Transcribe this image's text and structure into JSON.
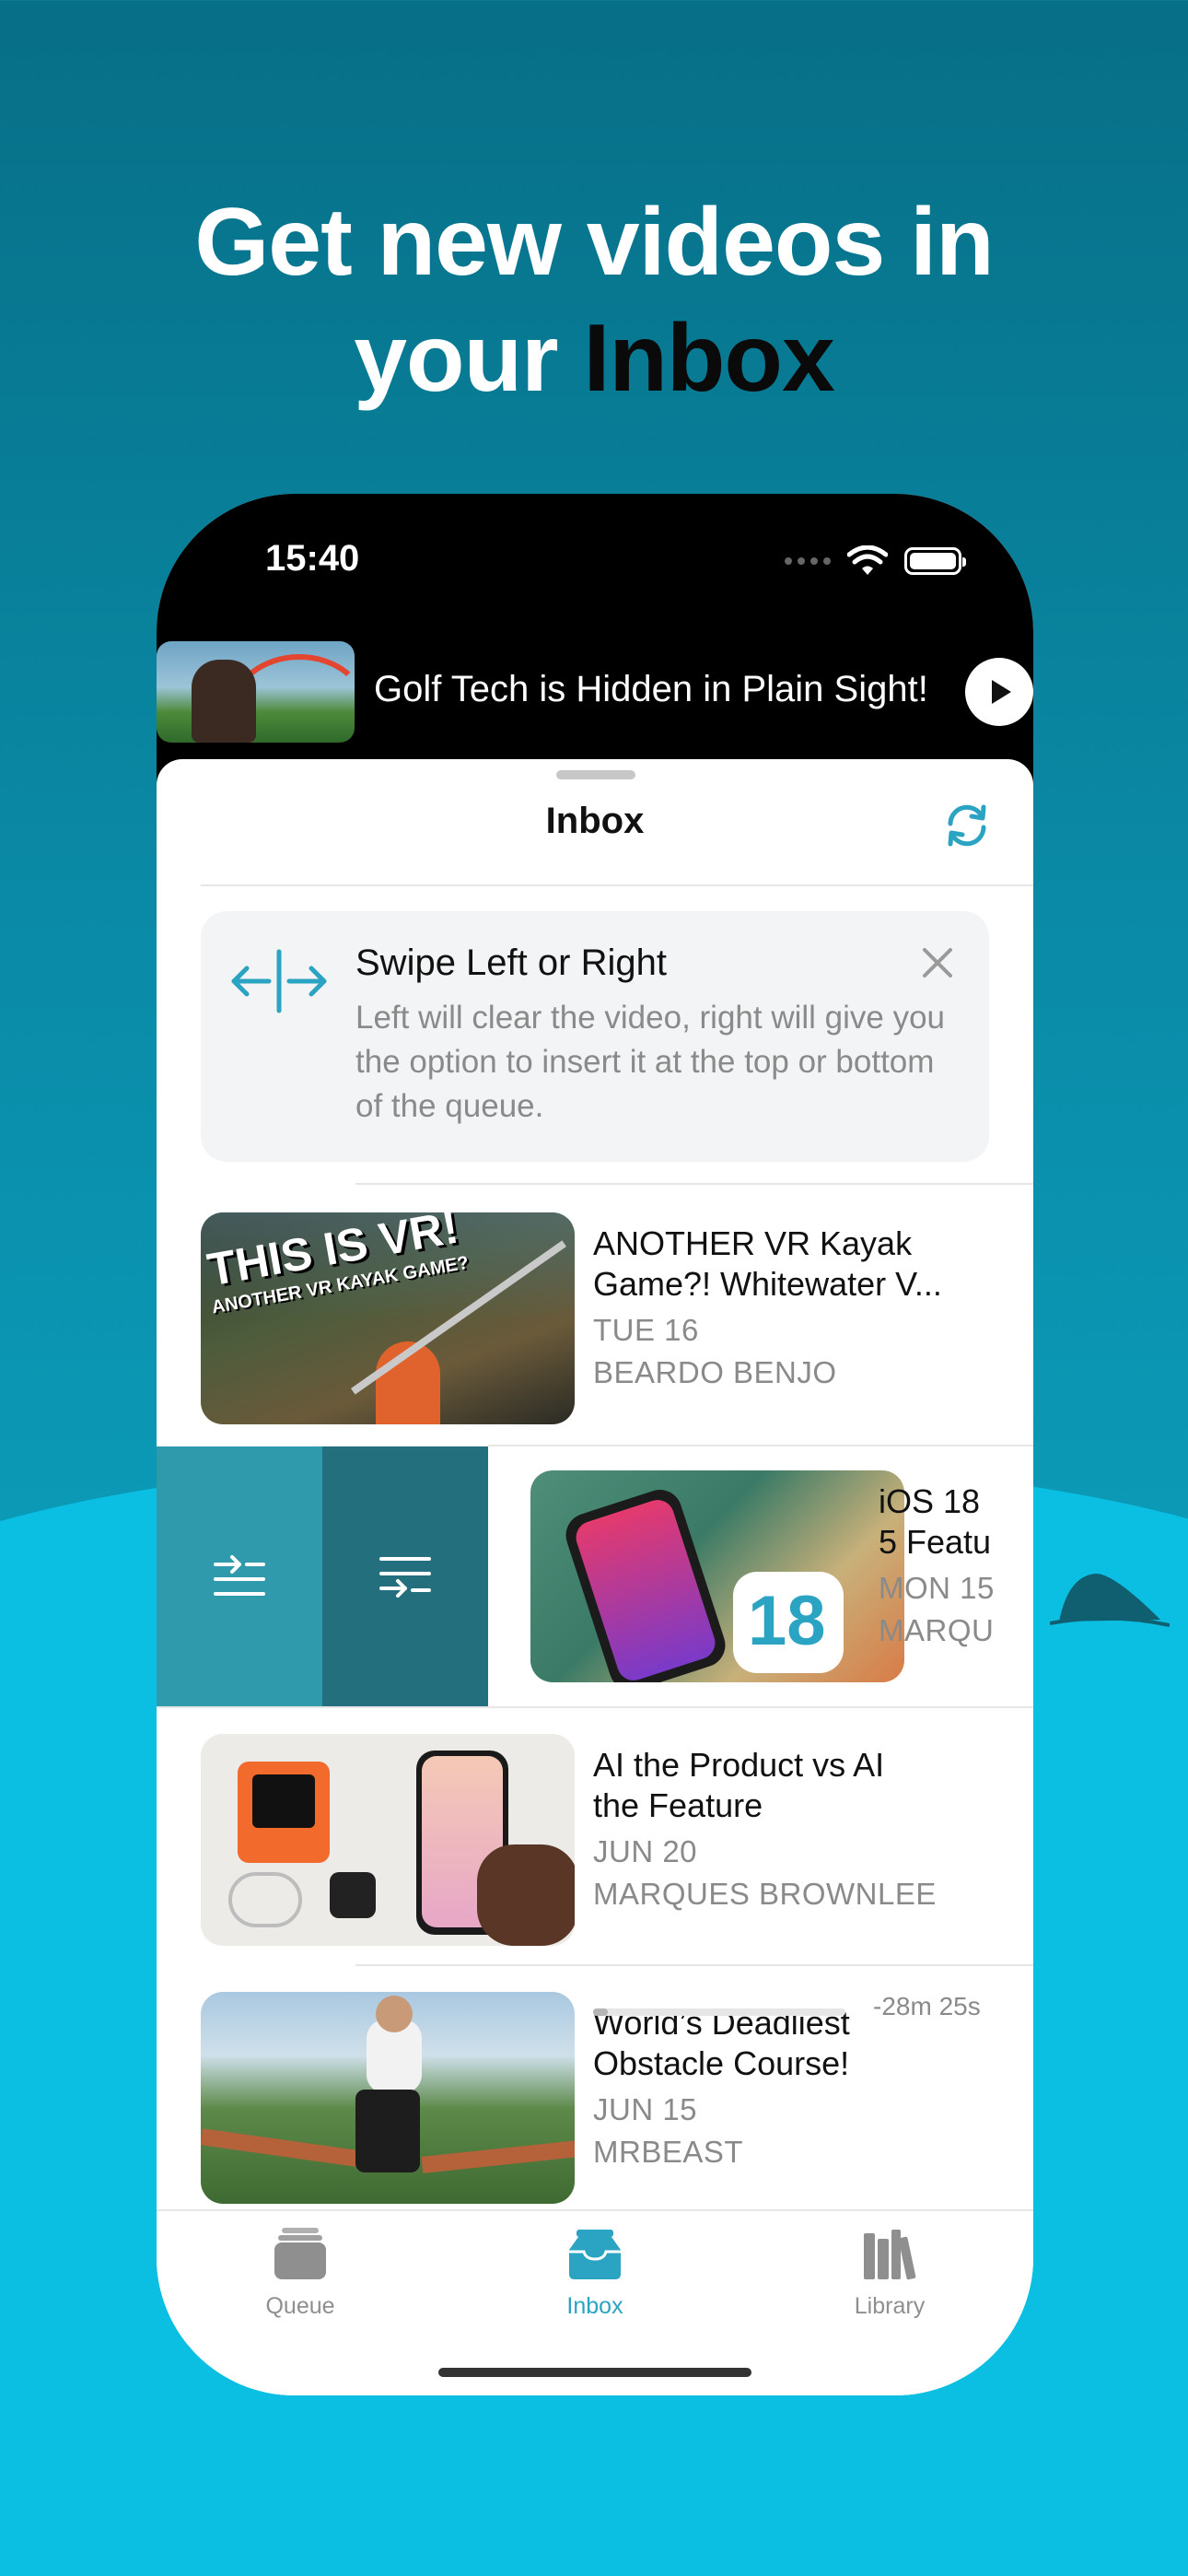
{
  "headline": {
    "line1": "Get new videos in",
    "line2_prefix": "your ",
    "line2_emphasis": "Inbox"
  },
  "status": {
    "time": "15:40"
  },
  "now_playing": {
    "title": "Golf Tech is Hidden in Plain Sight!",
    "play_icon": "play-icon"
  },
  "sheet": {
    "title": "Inbox",
    "refresh_icon": "refresh-icon"
  },
  "tip": {
    "title": "Swipe Left or Right",
    "body": "Left will clear the video, right will give you the option to insert it at the top or bottom of the queue.",
    "icon": "swipe-arrows-icon",
    "close_icon": "close-icon"
  },
  "videos": [
    {
      "title": "ANOTHER VR Kayak Game?! Whitewater V...",
      "date": "TUE 16",
      "channel": "BEARDO BENJO",
      "thumb_text1": "THIS IS VR!",
      "thumb_text2": "ANOTHER VR KAYAK GAME?"
    },
    {
      "title": "iOS 18 5 Featu",
      "title_l1": "iOS 18",
      "title_l2": "5 Featu",
      "date": "MON 15",
      "channel": "MARQU",
      "thumb_text": "18"
    },
    {
      "title": "AI the Product vs AI the Feature",
      "title_l1": "AI the Product vs AI",
      "title_l2": "the Feature",
      "date": "JUN 20",
      "channel": "MARQUES BROWNLEE"
    },
    {
      "title": "World’s Deadliest Obstacle Course!",
      "title_l1": "World’s Deadliest",
      "title_l2": "Obstacle Course!",
      "date": "JUN 15",
      "channel": "MRBEAST",
      "remaining": "-28m 25s",
      "progress": 0.06
    }
  ],
  "swipe_actions": [
    {
      "icon": "queue-top-icon",
      "color": "#2f9aac"
    },
    {
      "icon": "queue-bottom-icon",
      "color": "#236f7e"
    }
  ],
  "tabs": [
    {
      "label": "Queue",
      "icon": "queue-icon",
      "active": false
    },
    {
      "label": "Inbox",
      "icon": "inbox-icon",
      "active": true
    },
    {
      "label": "Library",
      "icon": "library-icon",
      "active": false
    }
  ],
  "colors": {
    "accent": "#2ba3c2",
    "bg_top": "#076f87",
    "bg_bottom": "#0bbfe3"
  }
}
